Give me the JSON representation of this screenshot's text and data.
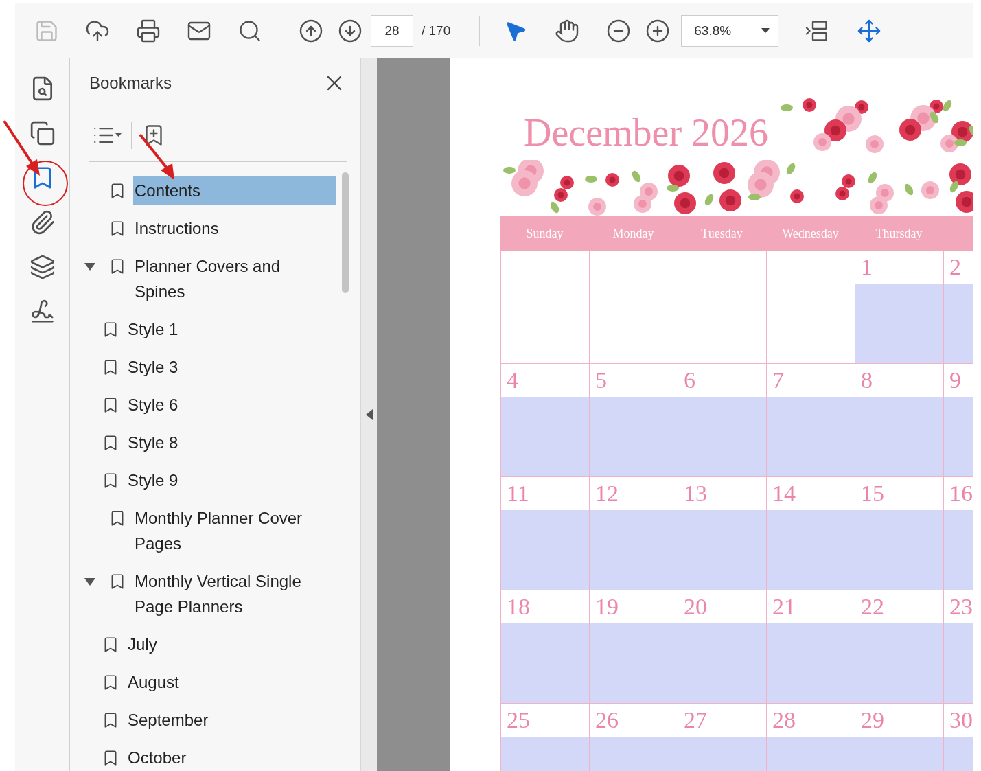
{
  "toolbar": {
    "page_number": "28",
    "page_total": "/ 170",
    "zoom": "63.8%"
  },
  "tool_rail": [
    {
      "kind": "pages",
      "selected": false
    },
    {
      "kind": "copy",
      "selected": false
    },
    {
      "kind": "bookmarks",
      "selected": true
    },
    {
      "kind": "attachments",
      "selected": false
    },
    {
      "kind": "layers",
      "selected": false
    },
    {
      "kind": "signature",
      "selected": false
    }
  ],
  "bookmarks_panel": {
    "title": "Bookmarks",
    "items": [
      {
        "label": "Contents",
        "selected": true
      },
      {
        "label": "Instructions",
        "selected": false
      },
      {
        "label": "Planner Covers and Spines",
        "selected": false,
        "expanded": true,
        "children": [
          {
            "label": "Style 1",
            "selected": false
          },
          {
            "label": "Style 3",
            "selected": false
          },
          {
            "label": "Style 6",
            "selected": false
          },
          {
            "label": "Style 8",
            "selected": false
          },
          {
            "label": "Style 9",
            "selected": false
          }
        ]
      },
      {
        "label": "Monthly Planner Cover Pages",
        "selected": false
      },
      {
        "label": "Monthly Vertical Single Page Planners",
        "selected": false,
        "expanded": true,
        "children": [
          {
            "label": "July",
            "selected": false
          },
          {
            "label": "August",
            "selected": false
          },
          {
            "label": "September",
            "selected": false
          },
          {
            "label": "October",
            "selected": false
          }
        ]
      }
    ]
  },
  "calendar": {
    "title": "December 2026",
    "weekdays": [
      "Sunday",
      "Monday",
      "Tuesday",
      "Wednesday",
      "Thursday"
    ],
    "weeks": [
      {
        "days": [
          {
            "in_month": false
          },
          {
            "in_month": false
          },
          {
            "in_month": false
          },
          {
            "in_month": false
          },
          {
            "in_month": true,
            "day": "1"
          },
          {
            "in_month": true,
            "day": "2"
          }
        ]
      },
      {
        "days": [
          {
            "in_month": true,
            "day": "4"
          },
          {
            "in_month": true,
            "day": "5"
          },
          {
            "in_month": true,
            "day": "6"
          },
          {
            "in_month": true,
            "day": "7"
          },
          {
            "in_month": true,
            "day": "8"
          },
          {
            "in_month": true,
            "day": "9"
          }
        ]
      },
      {
        "days": [
          {
            "in_month": true,
            "day": "11"
          },
          {
            "in_month": true,
            "day": "12"
          },
          {
            "in_month": true,
            "day": "13"
          },
          {
            "in_month": true,
            "day": "14"
          },
          {
            "in_month": true,
            "day": "15"
          },
          {
            "in_month": true,
            "day": "16"
          }
        ]
      },
      {
        "days": [
          {
            "in_month": true,
            "day": "18"
          },
          {
            "in_month": true,
            "day": "19"
          },
          {
            "in_month": true,
            "day": "20"
          },
          {
            "in_month": true,
            "day": "21"
          },
          {
            "in_month": true,
            "day": "22"
          },
          {
            "in_month": true,
            "day": "23"
          }
        ]
      },
      {
        "days": [
          {
            "in_month": true,
            "day": "25"
          },
          {
            "in_month": true,
            "day": "26"
          },
          {
            "in_month": true,
            "day": "27"
          },
          {
            "in_month": true,
            "day": "28"
          },
          {
            "in_month": true,
            "day": "29"
          },
          {
            "in_month": true,
            "day": "30"
          }
        ]
      }
    ]
  }
}
